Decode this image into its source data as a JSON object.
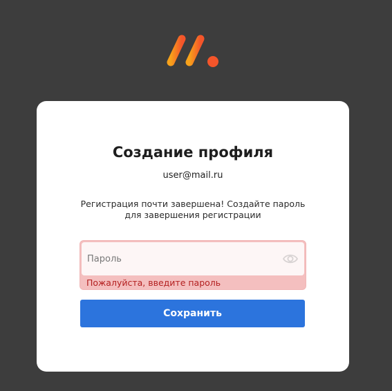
{
  "logo": {
    "icon": "brand-logo-icon",
    "colors": [
      "#f7a21b",
      "#f4552a"
    ]
  },
  "card": {
    "title": "Создание профиля",
    "email": "user@mail.ru",
    "description": "Регистрация почти завершена! Создайте пароль для завершения регистрации"
  },
  "password": {
    "placeholder": "Пароль",
    "value": "",
    "error": "Пожалуйста, введите пароль",
    "toggle_icon": "eye-icon"
  },
  "save": {
    "label": "Сохранить"
  },
  "colors": {
    "background": "#3d3d3d",
    "accent": "#2c74dd",
    "error_bg": "#f4bfbf",
    "error_text": "#b31f1f"
  }
}
